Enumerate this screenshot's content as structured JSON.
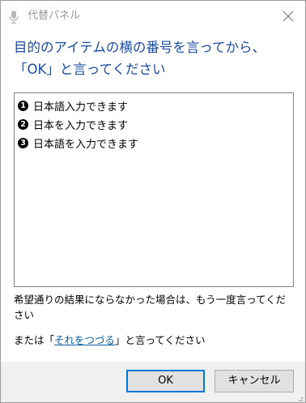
{
  "window": {
    "title": "代替パネル",
    "title_icon": "microphone-icon",
    "close_icon": "close-icon"
  },
  "instruction": "目的のアイテムの横の番号を言ってから、「OK」と言ってください",
  "alternates": [
    {
      "number": "1",
      "text": "日本語入力できます"
    },
    {
      "number": "2",
      "text": "日本を入力できます"
    },
    {
      "number": "3",
      "text": "日本語を入力できます"
    }
  ],
  "hint": "希望通りの結果にならなかった場合は、もう一度言ってください",
  "spell": {
    "prefix": "または「",
    "link": "それをつづる",
    "suffix": "」と言ってください"
  },
  "buttons": {
    "ok": "OK",
    "cancel": "キャンセル"
  },
  "colors": {
    "instruction_text": "#1d4ca0",
    "link": "#0b5fa5",
    "default_button_border": "#0078d7"
  }
}
